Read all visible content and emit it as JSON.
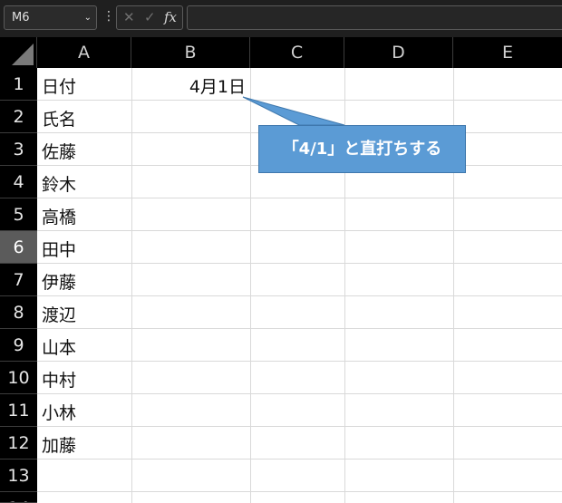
{
  "formula_bar": {
    "name_box": "M6",
    "name_box_chevron": "⌄",
    "options_glyph": "⋮",
    "cancel_glyph": "✕",
    "enter_glyph": "✓",
    "fx_label": "fx",
    "formula_value": ""
  },
  "columns": [
    "A",
    "B",
    "C",
    "D",
    "E"
  ],
  "rows": [
    "1",
    "2",
    "3",
    "4",
    "5",
    "6",
    "7",
    "8",
    "9",
    "10",
    "11",
    "12",
    "13",
    "14"
  ],
  "selected_row": "6",
  "cells": {
    "A1": "日付",
    "B1": "4月1日",
    "A2": "氏名",
    "A3": "佐藤",
    "A4": "鈴木",
    "A5": "高橋",
    "A6": "田中",
    "A7": "伊藤",
    "A8": "渡辺",
    "A9": "山本",
    "A10": "中村",
    "A11": "小林",
    "A12": "加藤"
  },
  "callout": {
    "text": "「4/1」と直打ちする",
    "fill": "#5b9bd5",
    "text_color": "#ffffff"
  }
}
